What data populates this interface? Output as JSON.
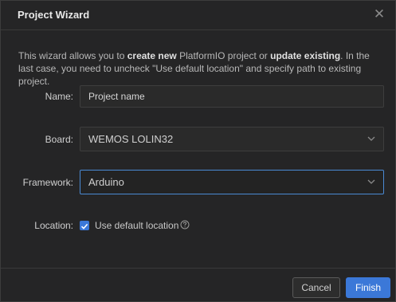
{
  "dialog": {
    "title": "Project Wizard",
    "close_glyph": "✕"
  },
  "intro": {
    "part1": "This wizard allows you to ",
    "bold1": "create new",
    "part2": " PlatformIO project or ",
    "bold2": "update existing",
    "part3": ". In the last case, you need to uncheck \"Use default location\" and specify path to existing project."
  },
  "form": {
    "name": {
      "label": "Name:",
      "value": "Project name"
    },
    "board": {
      "label": "Board:",
      "value": "WEMOS LOLIN32"
    },
    "framework": {
      "label": "Framework:",
      "value": "Arduino"
    },
    "location": {
      "label": "Location:",
      "checkbox_label": "Use default location",
      "checked": true
    }
  },
  "footer": {
    "cancel_label": "Cancel",
    "finish_label": "Finish"
  },
  "icons": {
    "close": "close-icon",
    "chevron": "chevron-down-icon",
    "help": "help-circle-icon",
    "check": "checkmark-icon"
  },
  "colors": {
    "accent": "#3b78d8",
    "background": "#252526",
    "focus_border": "#4a8ad4"
  }
}
